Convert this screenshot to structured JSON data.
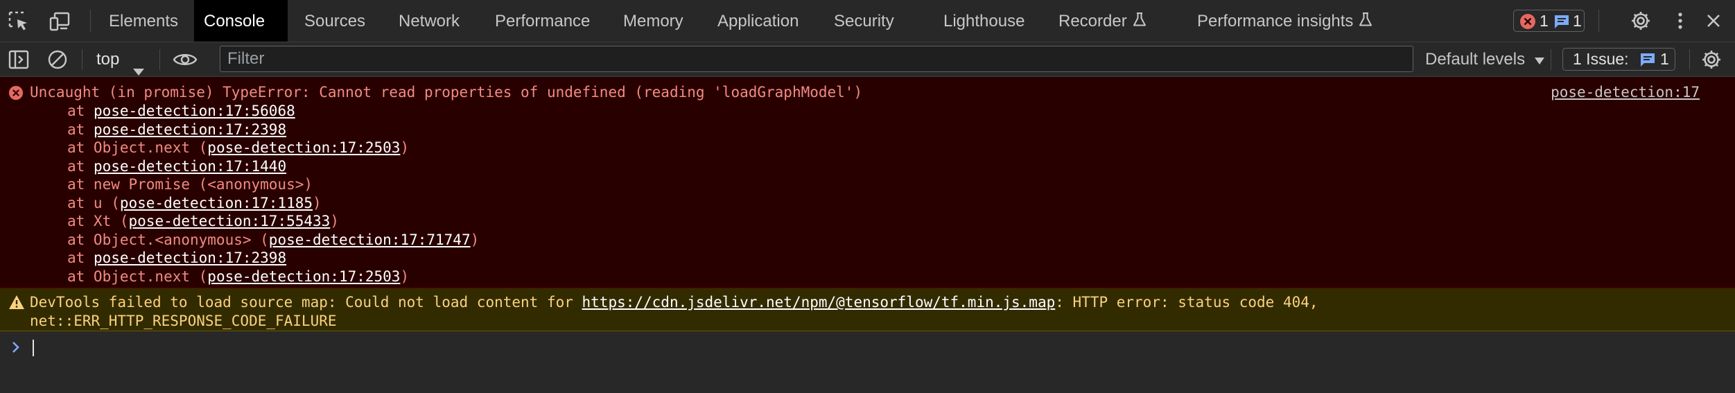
{
  "tabs": [
    {
      "label": "Elements",
      "active": false
    },
    {
      "label": "Console",
      "active": true
    },
    {
      "label": "Sources",
      "active": false
    },
    {
      "label": "Network",
      "active": false
    },
    {
      "label": "Performance",
      "active": false
    },
    {
      "label": "Memory",
      "active": false
    },
    {
      "label": "Application",
      "active": false
    },
    {
      "label": "Security",
      "active": false
    },
    {
      "label": "Lighthouse",
      "active": false
    },
    {
      "label": "Recorder",
      "active": false,
      "experimental": true
    },
    {
      "label": "Performance insights",
      "active": false,
      "experimental": true
    }
  ],
  "counters": {
    "errors": "1",
    "messages": "1"
  },
  "toolbar": {
    "context": "top",
    "filter_placeholder": "Filter",
    "levels": "Default levels",
    "issues_label": "1 Issue:",
    "issues_count": "1"
  },
  "error": {
    "message": "Uncaught (in promise) TypeError: Cannot read properties of undefined (reading 'loadGraphModel')",
    "source": "pose-detection:17",
    "frames": [
      {
        "prefix": "at ",
        "link": "pose-detection:17:56068",
        "suffix": ""
      },
      {
        "prefix": "at ",
        "link": "pose-detection:17:2398",
        "suffix": ""
      },
      {
        "prefix": "at Object.next (",
        "link": "pose-detection:17:2503",
        "suffix": ")"
      },
      {
        "prefix": "at ",
        "link": "pose-detection:17:1440",
        "suffix": ""
      },
      {
        "prefix": "at new Promise (<anonymous>)",
        "link": "",
        "suffix": ""
      },
      {
        "prefix": "at u (",
        "link": "pose-detection:17:1185",
        "suffix": ")"
      },
      {
        "prefix": "at Xt (",
        "link": "pose-detection:17:55433",
        "suffix": ")"
      },
      {
        "prefix": "at Object.<anonymous> (",
        "link": "pose-detection:17:71747",
        "suffix": ")"
      },
      {
        "prefix": "at ",
        "link": "pose-detection:17:2398",
        "suffix": ""
      },
      {
        "prefix": "at Object.next (",
        "link": "pose-detection:17:2503",
        "suffix": ")"
      }
    ]
  },
  "warning": {
    "prefix": "DevTools failed to load source map: Could not load content for ",
    "url": "https://cdn.jsdelivr.net/npm/@tensorflow/tf.min.js.map",
    "suffix": ": HTTP error: status code 404,",
    "line2": "net::ERR_HTTP_RESPONSE_CODE_FAILURE"
  },
  "colors": {
    "error_bg": "#290000",
    "error_text": "#f28b82",
    "warning_bg": "#332b00",
    "warning_text": "#f9d27e",
    "accent": "#7cacf8"
  }
}
